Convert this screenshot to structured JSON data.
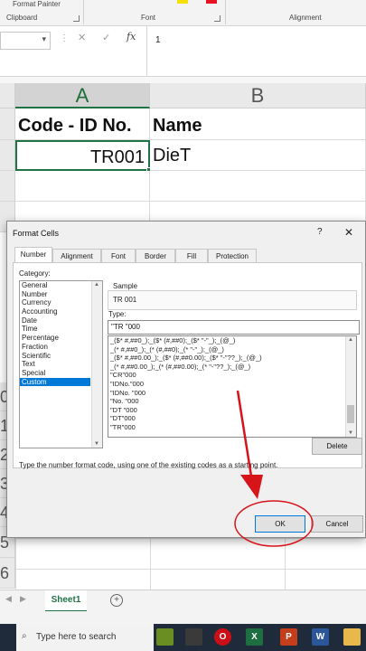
{
  "ribbon": {
    "format_painter": "Format Painter",
    "groups": [
      "Clipboard",
      "Font",
      "Alignment"
    ]
  },
  "formula_bar": {
    "name_box": "",
    "cancel_symbol": "✕",
    "enter_symbol": "✓",
    "fx_label": "fx",
    "content": "1"
  },
  "sheet": {
    "columns": [
      "A",
      "B"
    ],
    "rows": [
      {
        "header": "",
        "a": "Code - ID No.",
        "b": "Name"
      },
      {
        "header": "",
        "a": "TR001",
        "b": "DieT"
      }
    ],
    "visible_row_numbers": [
      "0",
      "1",
      "2",
      "3",
      "4",
      "5",
      "6"
    ]
  },
  "dialog": {
    "title": "Format Cells",
    "help": "?",
    "close": "✕",
    "tabs": [
      "Number",
      "Alignment",
      "Font",
      "Border",
      "Fill",
      "Protection"
    ],
    "active_tab": "Number",
    "category_label": "Category:",
    "categories": [
      "General",
      "Number",
      "Currency",
      "Accounting",
      "Date",
      "Time",
      "Percentage",
      "Fraction",
      "Scientific",
      "Text",
      "Special",
      "Custom"
    ],
    "selected_category": "Custom",
    "sample_label": "Sample",
    "sample_value": "TR 001",
    "type_label": "Type:",
    "type_value": "\"TR \"000",
    "type_list": [
      "_($* #,##0_);_($* (#,##0);_($* \"-\"_);_(@_)",
      "_(* #,##0_);_(* (#,##0);_(* \"-\"_);_(@_)",
      "_($* #,##0.00_);_($* (#,##0.00);_($* \"-\"??_);_(@_)",
      "_(* #,##0.00_);_(* (#,##0.00);_(* \"-\"??_);_(@_)",
      "\"CR\"000",
      "\"IDNo.\"000",
      "\"IDNo. \"000",
      "\"No. \"000",
      "\"DT \"000",
      "\"DT\"000",
      "\"TR\"000"
    ],
    "delete_button": "Delete",
    "description": "Type the number format code, using one of the existing codes as a starting point.",
    "ok_button": "OK",
    "cancel_button": "Cancel"
  },
  "sheet_tabs": {
    "active": "Sheet1",
    "add_symbol": "+"
  },
  "taskbar": {
    "search_placeholder": "Type here to search",
    "apps": [
      "Excel",
      "PowerPoint",
      "Word"
    ]
  },
  "colors": {
    "excel_green": "#217346",
    "selection_blue": "#0078d7",
    "annotation_red": "#d8141b"
  }
}
